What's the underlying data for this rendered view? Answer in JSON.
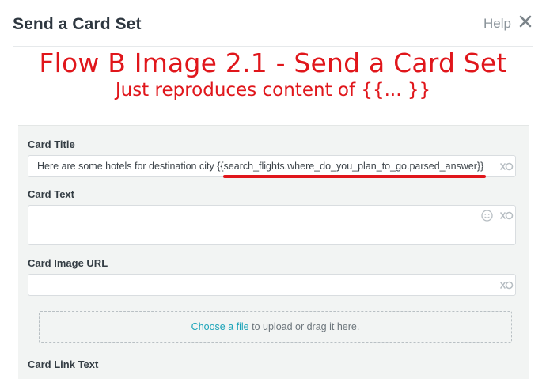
{
  "dialog": {
    "title": "Send a Card Set",
    "help_label": "Help",
    "close_icon": "close-icon"
  },
  "annotation": {
    "title": "Flow B Image 2.1 - Send a Card Set",
    "subtitle": "Just reproduces content of {{... }}",
    "color": "#e0161b"
  },
  "form": {
    "card_title": {
      "label": "Card Title",
      "prefix": "Here are some hotels for destination city ",
      "variable": "{{search_flights.where_do_you_plan_to_go.parsed_answer}}"
    },
    "card_text": {
      "label": "Card Text",
      "value": ""
    },
    "card_image_url": {
      "label": "Card Image URL",
      "value": ""
    },
    "upload": {
      "link_label": "Choose a file",
      "rest_label": " to upload or drag it here."
    },
    "card_link_text": {
      "label": "Card Link Text"
    }
  },
  "colors": {
    "accent_link": "#1aa3b8",
    "panel_bg": "#f2f4f3"
  }
}
